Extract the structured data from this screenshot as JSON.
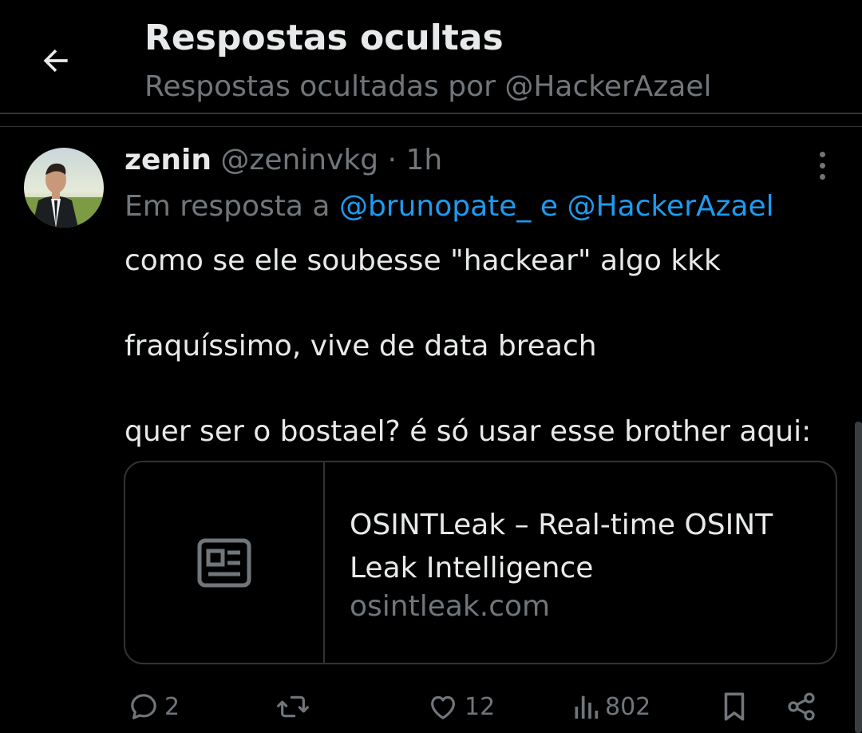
{
  "header": {
    "title": "Respostas ocultas",
    "subtitle": "Respostas ocultadas por @HackerAzael"
  },
  "post": {
    "display_name": "zenin",
    "handle": "@zeninvkg",
    "separator": "·",
    "time": "1h",
    "reply_prefix": "Em resposta a",
    "reply_to_1": "@brunopate_",
    "reply_joiner": "e",
    "reply_to_2": "@HackerAzael",
    "text": "como se ele soubesse \"hackear\" algo kkk\n\nfraquíssimo, vive de data breach\n\nquer ser o bostael? é só usar esse brother aqui:",
    "card": {
      "title": "OSINTLeak – Real-time OSINT Leak Intelligence",
      "domain": "osintleak.com",
      "thumb_icon": "article-icon"
    },
    "actions": {
      "replies": "2",
      "reposts": "",
      "likes": "12",
      "views": "802"
    }
  },
  "colors": {
    "background": "#000000",
    "text": "#e7e9ea",
    "muted": "#71767b",
    "link": "#1d9bf0",
    "border": "#2f3336"
  },
  "icons": {
    "back": "arrow-left-icon",
    "more": "more-vertical-icon",
    "reply": "reply-icon",
    "repost": "repost-icon",
    "like": "heart-icon",
    "views": "views-icon",
    "bookmark": "bookmark-icon",
    "share": "share-icon"
  }
}
